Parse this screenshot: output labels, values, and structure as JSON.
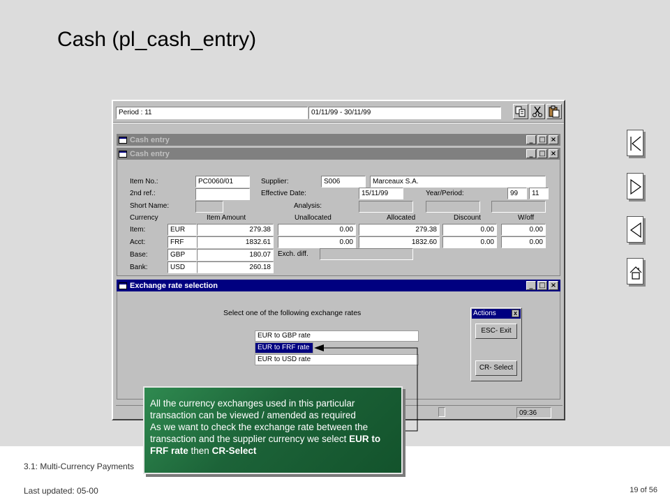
{
  "slide": {
    "title": "Cash (pl_cash_entry)",
    "footer_left": "3.1: Multi-Currency Payments",
    "last_updated": "Last updated:  05-00",
    "page": "19 of 56"
  },
  "app": {
    "period_label": "Period : 11",
    "period_range": "01/11/99 - 30/11/99",
    "status_time": "09:36"
  },
  "windows": {
    "cash_entry_back": "Cash entry",
    "cash_entry_front": "Cash entry",
    "exchange": "Exchange rate selection"
  },
  "form": {
    "labels": {
      "item_no": "Item No.:",
      "second_ref": "2nd ref.:",
      "short_name": "Short Name:",
      "currency": "Currency",
      "item": "Item:",
      "acct": "Acct:",
      "base": "Base:",
      "bank": "Bank:",
      "supplier": "Supplier:",
      "effective_date": "Effective Date:",
      "year_period": "Year/Period:",
      "analysis": "Analysis:",
      "item_amount": "Item Amount",
      "unallocated": "Unallocated",
      "allocated": "Allocated",
      "discount": "Discount",
      "woff": "W/off",
      "exch_diff": "Exch. diff."
    },
    "item_no": "PC0060/01",
    "supplier_code": "S006",
    "supplier_name": "Marceaux S.A.",
    "effective_date": "15/11/99",
    "year": "99",
    "period": "11",
    "rows": [
      {
        "currency": "EUR",
        "amount": "279.38",
        "unallocated": "0.00",
        "allocated": "279.38",
        "discount": "0.00",
        "woff": "0.00"
      },
      {
        "currency": "FRF",
        "amount": "1832.61",
        "unallocated": "0.00",
        "allocated": "1832.60",
        "discount": "0.00",
        "woff": "0.00"
      },
      {
        "currency": "GBP",
        "amount": "180.07"
      },
      {
        "currency": "USD",
        "amount": "260.18"
      }
    ]
  },
  "exchange": {
    "prompt": "Select one of the following exchange rates",
    "options": [
      "EUR to GBP rate",
      "EUR to FRF rate",
      "EUR to USD rate"
    ],
    "selected_index": 1
  },
  "actions": {
    "title": "Actions",
    "close": "x",
    "esc": "ESC- Exit",
    "cr": "CR- Select"
  },
  "callout": {
    "line1": "All the currency exchanges used in this particular transaction can be viewed / amended as required",
    "line2": "As we want to check the exchange rate between the transaction and the supplier currency we select",
    "bold1": "EUR to FRF rate",
    "mid": "then",
    "bold2": "CR-Select"
  },
  "icons": [
    "copy-icon",
    "cut-icon",
    "paste-icon",
    "first-page-icon",
    "next-page-icon",
    "previous-page-icon",
    "home-icon",
    "arrow-icon"
  ],
  "colors": {
    "active_title": "#000080",
    "inactive_title": "#808080",
    "callout_green": "#1c6338",
    "window_face": "#c0c0c0"
  }
}
